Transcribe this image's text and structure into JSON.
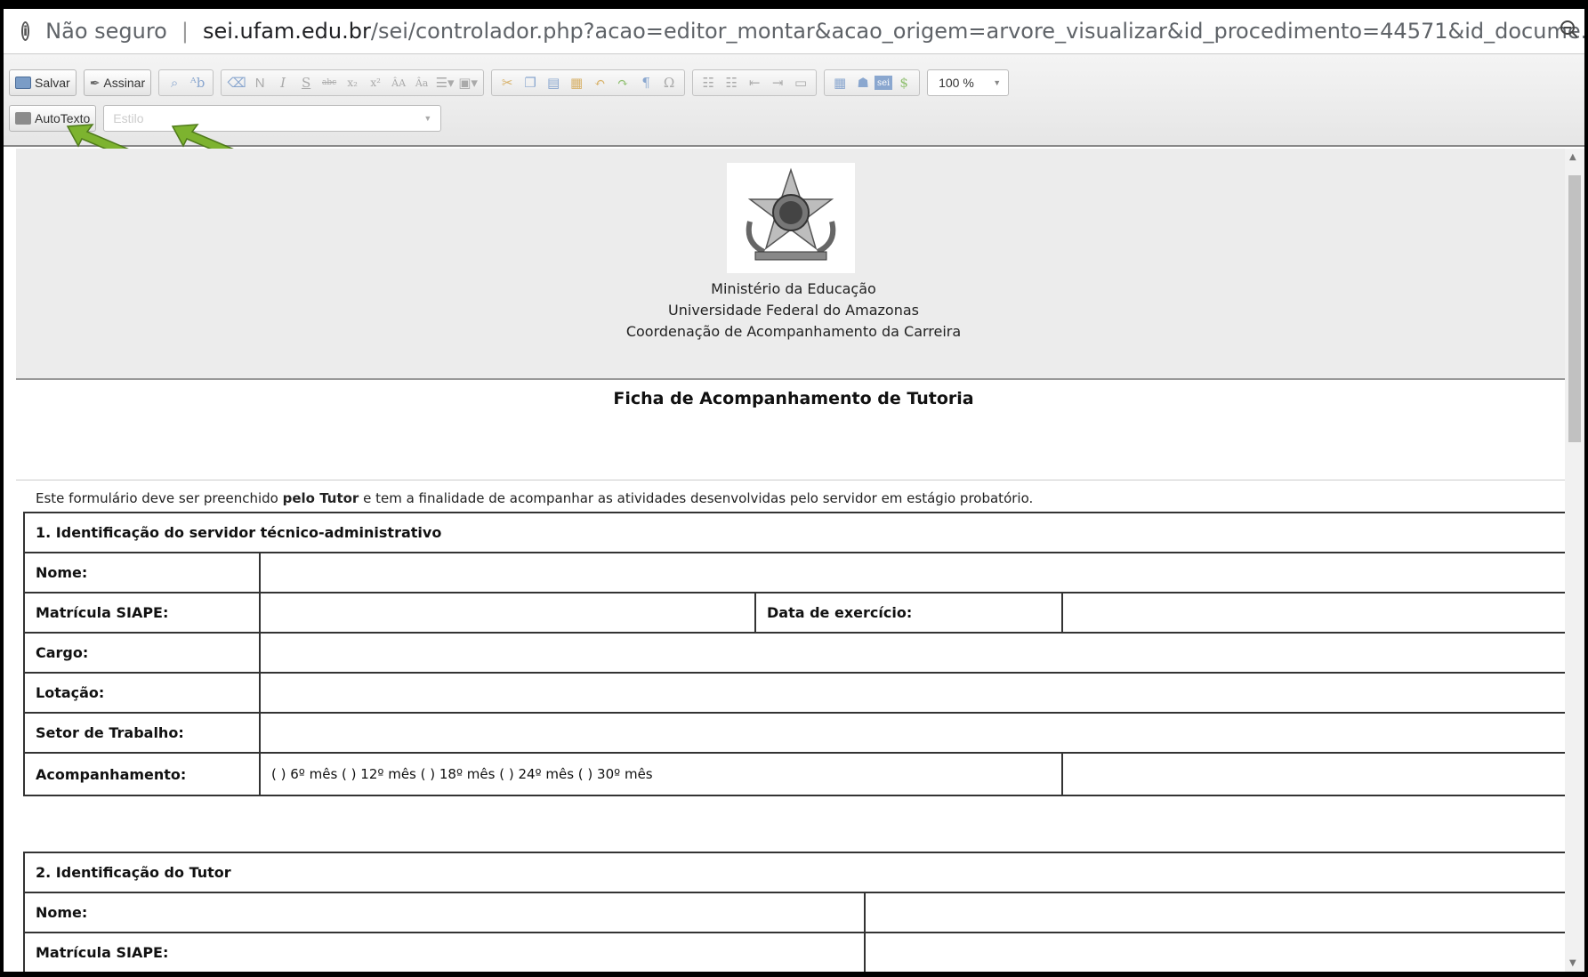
{
  "browser": {
    "security_label": "Não seguro",
    "separator": "|",
    "url_domain": "sei.ufam.edu.br",
    "url_path": "/sei/controlador.php?acao=editor_montar&acao_origem=arvore_visualizar&id_procedimento=44571&id_docume..."
  },
  "toolbar": {
    "save_label": "Salvar",
    "sign_label": "Assinar",
    "zoom_value": "100 %",
    "autotext_label": "AutoTexto",
    "style_placeholder": "Estilo",
    "format_buttons": [
      "N",
      "I",
      "S",
      "abc",
      "x₂",
      "x²",
      "ÂA",
      "Âa"
    ],
    "misc_buttons": [
      "¶",
      "Ω"
    ],
    "colors": {
      "highlight": "#8fbf6f",
      "arrow": "#7db32f"
    }
  },
  "document": {
    "header_lines": [
      "Ministério da Educação",
      "Universidade Federal do Amazonas",
      "Coordenação de Acompanhamento da Carreira"
    ],
    "title": "Ficha de Acompanhamento de Tutoria",
    "intro_before": "Este formulário deve ser preenchido ",
    "intro_bold": "pelo Tutor",
    "intro_after": " e tem a finalidade de acompanhar as atividades desenvolvidas pelo servidor em estágio probatório.",
    "section1": {
      "heading": "1. Identificação do servidor técnico-administrativo",
      "nome": "Nome:",
      "matricula": "Matrícula SIAPE:",
      "data_exercicio": "Data de exercício:",
      "cargo": "Cargo:",
      "lotacao": "Lotação:",
      "setor": "Setor de Trabalho:",
      "acompanhamento": "Acompanhamento:",
      "acompanhamento_options": "( ) 6º mês  ( ) 12º mês  (   ) 18º mês   (  ) 24º mês  (  ) 30º mês"
    },
    "section2": {
      "heading": "2. Identificação do Tutor",
      "nome": "Nome:",
      "matricula": "Matrícula SIAPE:"
    }
  }
}
